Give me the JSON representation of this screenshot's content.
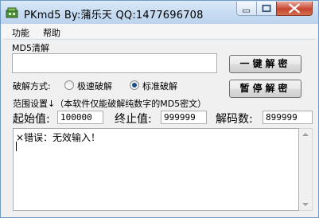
{
  "window": {
    "title": "PKmd5  By:蒲乐天  QQ:1477696708"
  },
  "menu": {
    "items": [
      "功能",
      "帮助"
    ]
  },
  "md5_group": {
    "label": "MD5清解",
    "input_value": ""
  },
  "buttons": {
    "crack": "一键解密",
    "pause": "暂停解密"
  },
  "crack_mode": {
    "label": "破解方式:",
    "options": [
      "极速破解",
      "标准破解"
    ],
    "selected": "标准破解"
  },
  "range": {
    "label": "范围设置↓（本软件仅能破解纯数字的MD5密文）",
    "start_label": "起始值:",
    "start_value": "100000",
    "end_label": "终止值:",
    "end_value": "999999",
    "count_label": "解码数:",
    "count_value": "899999"
  },
  "output": {
    "text": "×错误：无效输入！"
  }
}
